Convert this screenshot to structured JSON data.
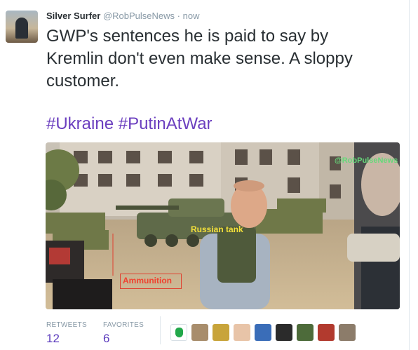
{
  "tweet": {
    "fullname": "Silver Surfer",
    "username": "@RobPulseNews",
    "separator": "·",
    "timestamp": "now",
    "text_lines": [
      "GWP's sentences he is paid to say by",
      "Kremlin don't even make sense. A sloppy",
      "customer."
    ],
    "hashtags": [
      "#Ukraine",
      "#PutinAtWar"
    ]
  },
  "media": {
    "watermark": "@RobPulseNews",
    "labels": {
      "tank": "Russian tank",
      "ammo": "Ammunition"
    }
  },
  "stats": {
    "retweets_label": "RETWEETS",
    "retweets_count": "12",
    "favorites_label": "FAVORITES",
    "favorites_count": "6"
  },
  "favoriters": [
    {
      "name": "favoriter-avatar-1",
      "color": "#22a84a"
    },
    {
      "name": "favoriter-avatar-2",
      "color": "#a88d6c"
    },
    {
      "name": "favoriter-avatar-3",
      "color": "#c8a43a"
    },
    {
      "name": "favoriter-avatar-4",
      "color": "#e8c4a8"
    },
    {
      "name": "favoriter-avatar-5",
      "color": "#3a6db8"
    },
    {
      "name": "favoriter-avatar-6",
      "color": "#2b2b2b"
    },
    {
      "name": "favoriter-avatar-7",
      "color": "#4d6b3a"
    },
    {
      "name": "favoriter-avatar-8",
      "color": "#b23a2e"
    },
    {
      "name": "favoriter-avatar-9",
      "color": "#8c7c6a"
    }
  ],
  "colors": {
    "accent": "#5b3bbd",
    "hashtag": "#6b3fbf",
    "muted": "#8899a6"
  }
}
